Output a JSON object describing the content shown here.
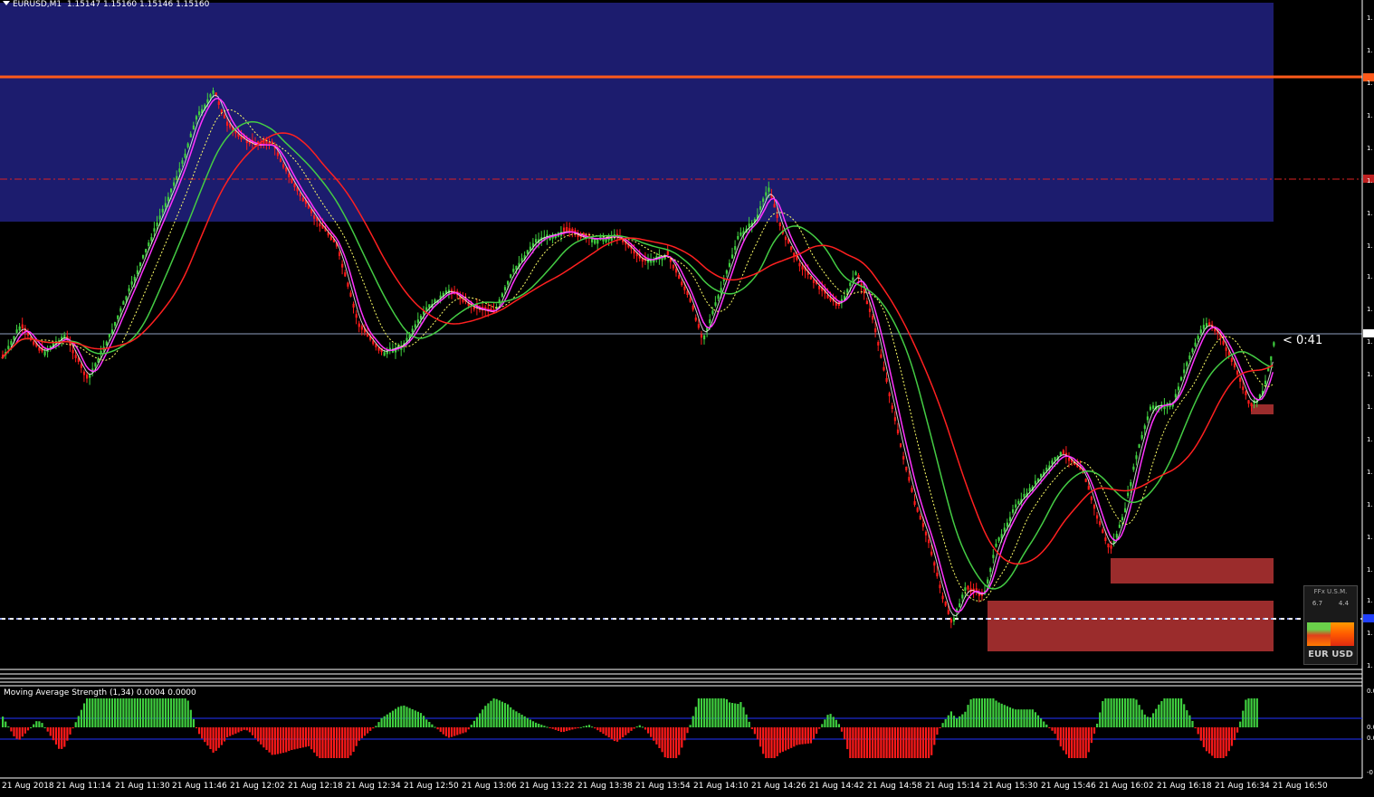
{
  "header": {
    "symbol_label": "EURUSD,M1",
    "ohlc": "1.15147 1.15160 1.15146 1.15160"
  },
  "countdown": "< 0:41",
  "indicator": {
    "label": "Moving Average Strength (1,34) 0.0004 0.0000"
  },
  "x_axis_labels": [
    "21 Aug 2018",
    "21 Aug 11:14",
    "21 Aug 11:30",
    "21 Aug 11:46",
    "21 Aug 12:02",
    "21 Aug 12:18",
    "21 Aug 12:34",
    "21 Aug 12:50",
    "21 Aug 13:06",
    "21 Aug 13:22",
    "21 Aug 13:38",
    "21 Aug 13:54",
    "21 Aug 14:10",
    "21 Aug 14:26",
    "21 Aug 14:42",
    "21 Aug 14:58",
    "21 Aug 15:14",
    "21 Aug 15:30",
    "21 Aug 15:46",
    "21 Aug 16:02",
    "21 Aug 16:18",
    "21 Aug 16:34",
    "21 Aug 16:50"
  ],
  "y_axis_labels": [
    "1.",
    "1.",
    "1.",
    "1.",
    "1.",
    "1.",
    "1.",
    "1.",
    "1.",
    "1.",
    "1.",
    "1.",
    "1.",
    "1.",
    "1.",
    "1.",
    "1.",
    "1.",
    "1.",
    "1.",
    "1."
  ],
  "indicator_axis_labels": [
    "0.0",
    "0.0",
    "0.0",
    "-0"
  ],
  "widget": {
    "title": "FFx U.S.M.",
    "left_value": "6.7",
    "right_value": "4.4",
    "pair": "EUR USD"
  },
  "colors": {
    "background": "#000000",
    "supply_zone": "#1c1c6e",
    "demand_zone": "#9b2c2c",
    "bull_candle": "#3fcf3f",
    "bear_candle": "#ff1a1a",
    "ma_fast": "#ff33ff",
    "ma_slow": "#ff2020",
    "ma_green": "#44cc44",
    "ma_dotted": "#ffff66",
    "resistance_line": "#ff5a1a",
    "price_line": "#8fa0c0"
  }
}
